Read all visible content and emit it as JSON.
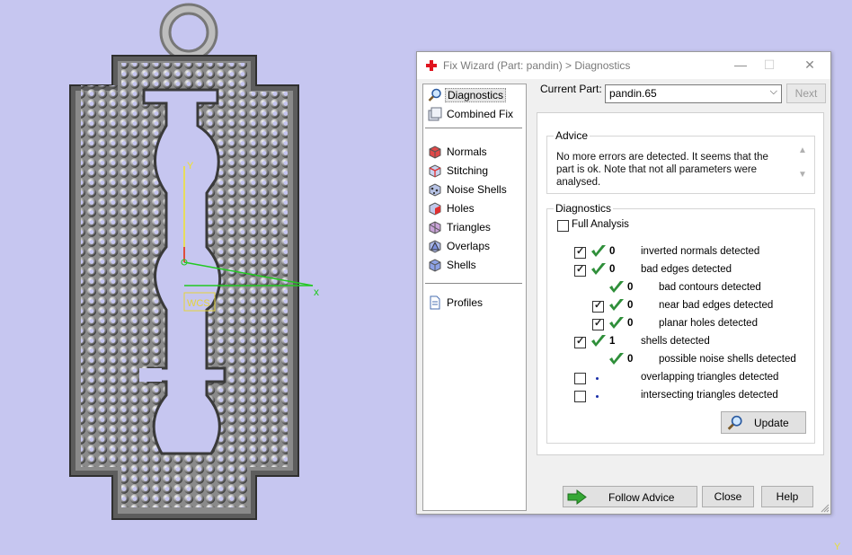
{
  "window": {
    "title": "Fix Wizard (Part: pandin) > Diagnostics",
    "controls": {
      "minimize": "—",
      "maximize": "☐",
      "close": "✕"
    }
  },
  "nav": {
    "items": [
      {
        "label": "Diagnostics",
        "icon": "magnifier-icon",
        "selected": true
      },
      {
        "label": "Combined Fix",
        "icon": "combined-fix-icon"
      },
      {
        "label": "Normals",
        "icon": "normals-cube-icon"
      },
      {
        "label": "Stitching",
        "icon": "stitching-cube-icon"
      },
      {
        "label": "Noise Shells",
        "icon": "noise-shells-icon"
      },
      {
        "label": "Holes",
        "icon": "holes-cube-icon"
      },
      {
        "label": "Triangles",
        "icon": "triangles-icon"
      },
      {
        "label": "Overlaps",
        "icon": "overlaps-icon"
      },
      {
        "label": "Shells",
        "icon": "shells-icon"
      },
      {
        "label": "Profiles",
        "icon": "profiles-doc-icon"
      }
    ]
  },
  "current_part": {
    "label": "Current Part:",
    "value": "pandin.65",
    "next_label": "Next"
  },
  "advice": {
    "title": "Advice",
    "text": "No more errors are detected. It seems that the part is ok. Note that not all parameters were analysed."
  },
  "diagnostics": {
    "title": "Diagnostics",
    "full_analysis_label": "Full Analysis",
    "rows": [
      {
        "checked": true,
        "status": "ok",
        "count": "0",
        "text": "inverted normals detected",
        "level": 0
      },
      {
        "checked": true,
        "status": "ok",
        "count": "0",
        "text": "bad edges detected",
        "level": 0
      },
      {
        "checked": null,
        "status": "ok",
        "count": "0",
        "text": "bad contours detected",
        "level": 2
      },
      {
        "checked": true,
        "status": "ok",
        "count": "0",
        "text": "near bad edges detected",
        "level": 1
      },
      {
        "checked": true,
        "status": "ok",
        "count": "0",
        "text": "planar holes detected",
        "level": 1
      },
      {
        "checked": true,
        "status": "ok",
        "count": "1",
        "text": "shells detected",
        "level": 0
      },
      {
        "checked": null,
        "status": "ok",
        "count": "0",
        "text": "possible noise shells detected",
        "level": 2
      },
      {
        "checked": false,
        "status": "pending",
        "count": "",
        "text": "overlapping triangles detected",
        "level": 0
      },
      {
        "checked": false,
        "status": "pending",
        "count": "",
        "text": "intersecting triangles detected",
        "level": 0
      }
    ],
    "update_label": "Update"
  },
  "footer": {
    "follow_label": "Follow Advice",
    "close_label": "Close",
    "help_label": "Help"
  },
  "viewport": {
    "wcs_label": "WCS",
    "y_axis_label": "Y",
    "x_axis_label": "x",
    "corner_axis_label": "Y"
  },
  "colors": {
    "background": "#c6c6f0",
    "check_green": "#2f8f3a",
    "status_dot": "#1a2ea8",
    "follow_arrow": "#2e9b2e"
  }
}
